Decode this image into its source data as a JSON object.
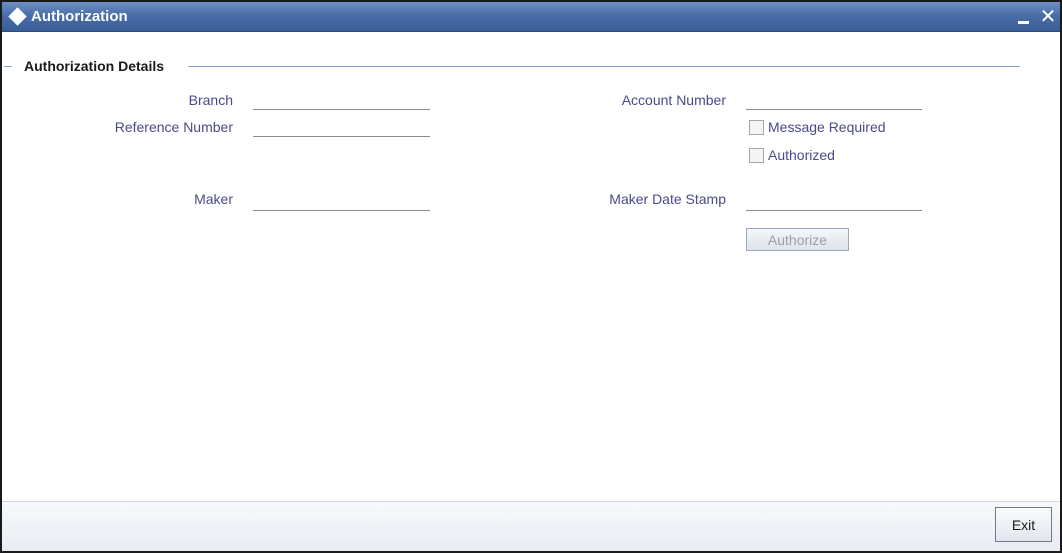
{
  "window": {
    "title": "Authorization",
    "close_glyph": "✕"
  },
  "section": {
    "title": "Authorization Details"
  },
  "fields": {
    "branch": {
      "label": "Branch",
      "value": ""
    },
    "reference_number": {
      "label": "Reference Number",
      "value": ""
    },
    "maker": {
      "label": "Maker",
      "value": ""
    },
    "account_number": {
      "label": "Account Number",
      "value": ""
    },
    "maker_date_stamp": {
      "label": "Maker Date Stamp",
      "value": ""
    }
  },
  "checkboxes": {
    "message_required": {
      "label": "Message Required",
      "checked": false
    },
    "authorized": {
      "label": "Authorized",
      "checked": false
    }
  },
  "buttons": {
    "authorize": "Authorize",
    "exit": "Exit"
  },
  "icons": {
    "title": "diamond-icon",
    "minimize": "minimize-icon",
    "close": "close-icon"
  },
  "colors": {
    "titlebar": "#4a6ea8",
    "label": "#4a4a8a",
    "section_line": "#8aa3c8"
  }
}
